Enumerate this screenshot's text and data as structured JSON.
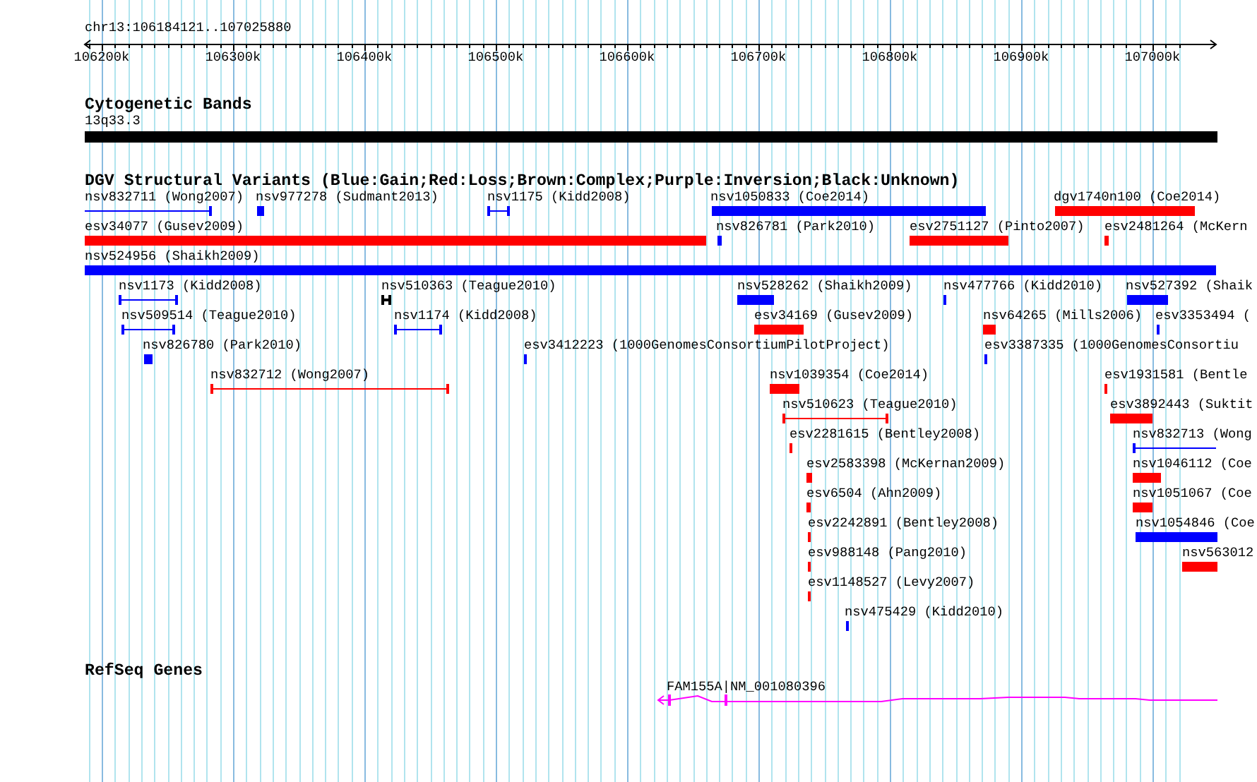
{
  "ruler": {
    "location": "chr13:106184121..107025880",
    "ticks": [
      "106200k",
      "106300k",
      "106400k",
      "106500k",
      "106600k",
      "106700k",
      "106800k",
      "106900k",
      "107000k"
    ]
  },
  "tracks": [
    {
      "title": "Cytogenetic Bands",
      "features": [
        {
          "label": "13q33.3",
          "kind": "band",
          "color": "#000000"
        }
      ]
    },
    {
      "title": "DGV Structural Variants (Blue:Gain;Red:Loss;Brown:Complex;Purple:Inversion;Black:Unknown)",
      "features": [
        {
          "label": "nsv832711 (Wong2007)",
          "kind": "interval",
          "color": "#0000ff"
        },
        {
          "label": "nsv977278 (Sudmant2013)",
          "kind": "bar",
          "color": "#0000ff"
        },
        {
          "label": "nsv1175 (Kidd2008)",
          "kind": "interval",
          "color": "#0000ff"
        },
        {
          "label": "nsv1050833 (Coe2014)",
          "kind": "bar",
          "color": "#0000ff"
        },
        {
          "label": "dgv1740n100 (Coe2014)",
          "kind": "bar",
          "color": "#ff0000"
        },
        {
          "label": "esv34077 (Gusev2009)",
          "kind": "bar",
          "color": "#ff0000"
        },
        {
          "label": "nsv826781 (Park2010)",
          "kind": "bar",
          "color": "#0000ff"
        },
        {
          "label": "esv2751127 (Pinto2007)",
          "kind": "bar",
          "color": "#ff0000"
        },
        {
          "label": "esv2481264 (McKern",
          "kind": "bar",
          "color": "#ff0000"
        },
        {
          "label": "nsv524956 (Shaikh2009)",
          "kind": "bar",
          "color": "#0000ff"
        },
        {
          "label": "nsv1173 (Kidd2008)",
          "kind": "interval",
          "color": "#0000ff"
        },
        {
          "label": "nsv510363 (Teague2010)",
          "kind": "interval",
          "color": "#000000"
        },
        {
          "label": "nsv528262 (Shaikh2009)",
          "kind": "bar",
          "color": "#0000ff"
        },
        {
          "label": "nsv477766 (Kidd2010)",
          "kind": "bar",
          "color": "#0000ff"
        },
        {
          "label": "nsv527392 (Shaik",
          "kind": "bar",
          "color": "#0000ff"
        },
        {
          "label": "nsv509514 (Teague2010)",
          "kind": "interval",
          "color": "#0000ff"
        },
        {
          "label": "nsv1174 (Kidd2008)",
          "kind": "interval",
          "color": "#0000ff"
        },
        {
          "label": "esv34169 (Gusev2009)",
          "kind": "bar",
          "color": "#ff0000"
        },
        {
          "label": "nsv64265 (Mills2006)",
          "kind": "bar",
          "color": "#ff0000"
        },
        {
          "label": "esv3353494 (",
          "kind": "bar",
          "color": "#0000ff"
        },
        {
          "label": "nsv826780 (Park2010)",
          "kind": "bar",
          "color": "#0000ff"
        },
        {
          "label": "esv3412223 (1000GenomesConsortiumPilotProject)",
          "kind": "bar",
          "color": "#0000ff"
        },
        {
          "label": "esv3387335 (1000GenomesConsortiu",
          "kind": "bar",
          "color": "#0000ff"
        },
        {
          "label": "nsv832712 (Wong2007)",
          "kind": "interval",
          "color": "#ff0000"
        },
        {
          "label": "nsv1039354 (Coe2014)",
          "kind": "bar",
          "color": "#ff0000"
        },
        {
          "label": "esv1931581 (Bentle",
          "kind": "bar",
          "color": "#ff0000"
        },
        {
          "label": "nsv510623 (Teague2010)",
          "kind": "interval",
          "color": "#ff0000"
        },
        {
          "label": "esv3892443 (Suktit",
          "kind": "bar",
          "color": "#ff0000"
        },
        {
          "label": "esv2281615 (Bentley2008)",
          "kind": "bar",
          "color": "#ff0000"
        },
        {
          "label": "nsv832713 (Wong",
          "kind": "interval",
          "color": "#0000ff"
        },
        {
          "label": "esv2583398 (McKernan2009)",
          "kind": "bar",
          "color": "#ff0000"
        },
        {
          "label": "nsv1046112 (Coe",
          "kind": "bar",
          "color": "#ff0000"
        },
        {
          "label": "esv6504 (Ahn2009)",
          "kind": "bar",
          "color": "#ff0000"
        },
        {
          "label": "nsv1051067 (Coe",
          "kind": "bar",
          "color": "#ff0000"
        },
        {
          "label": "esv2242891 (Bentley2008)",
          "kind": "bar",
          "color": "#ff0000"
        },
        {
          "label": "nsv1054846 (Coe",
          "kind": "bar",
          "color": "#0000ff"
        },
        {
          "label": "esv988148 (Pang2010)",
          "kind": "bar",
          "color": "#ff0000"
        },
        {
          "label": "nsv563012",
          "kind": "bar",
          "color": "#ff0000"
        },
        {
          "label": "esv1148527 (Levy2007)",
          "kind": "bar",
          "color": "#ff0000"
        },
        {
          "label": "nsv475429 (Kidd2010)",
          "kind": "bar",
          "color": "#0000ff"
        }
      ]
    },
    {
      "title": "RefSeq Genes",
      "features": [
        {
          "label": "FAM155A|NM_001080396",
          "kind": "gene",
          "color": "#ff00ff"
        }
      ]
    }
  ]
}
